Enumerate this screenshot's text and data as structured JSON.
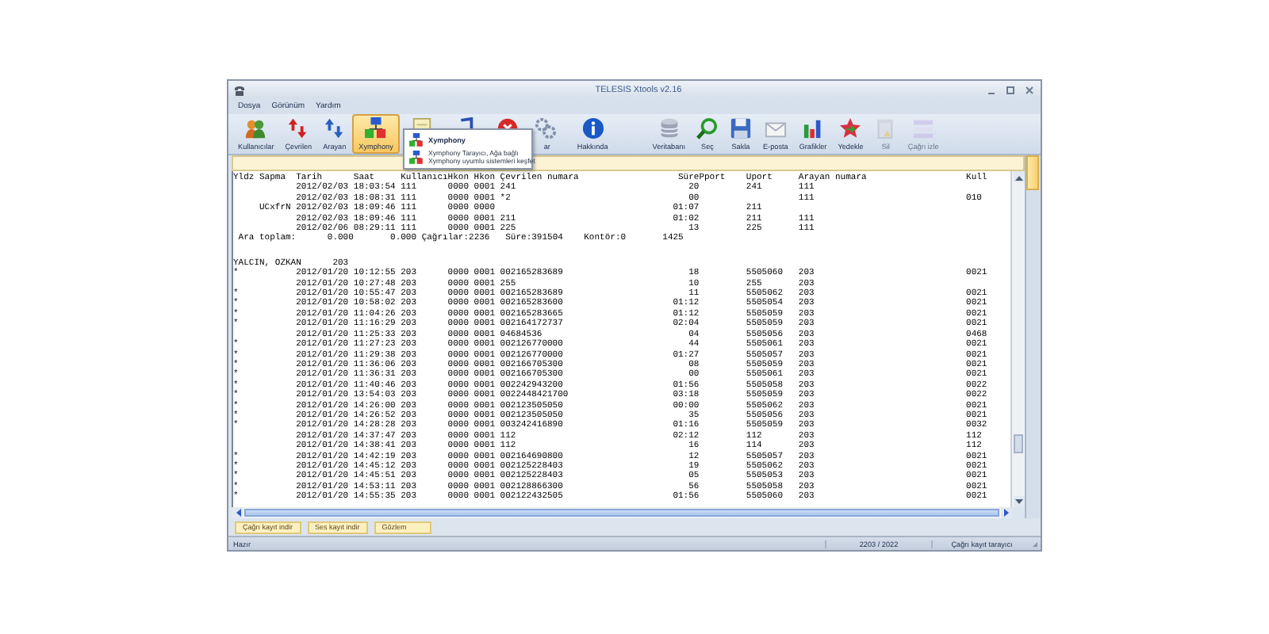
{
  "window": {
    "title": "TELESIS Xtools v2.16"
  },
  "menu": [
    "Dosya",
    "Görünüm",
    "Yardım"
  ],
  "toolbar": {
    "left": [
      {
        "kind": "users",
        "label": "Kullanıcılar",
        "highlighted": false,
        "disabled": false
      },
      {
        "kind": "dialed",
        "label": "Çevrilen",
        "highlighted": false,
        "disabled": false
      },
      {
        "kind": "caller",
        "label": "Arayan",
        "highlighted": false,
        "disabled": false
      },
      {
        "kind": "network",
        "label": "Xymphony",
        "highlighted": true,
        "disabled": false
      },
      {
        "kind": "notepad",
        "highlighted": false,
        "disabled": false
      },
      {
        "kind": "music",
        "highlighted": false,
        "disabled": false
      },
      {
        "kind": "stop",
        "highlighted": false,
        "disabled": false
      },
      {
        "kind": "gears",
        "label": "ar",
        "highlighted": false,
        "disabled": false
      },
      {
        "kind": "info",
        "label": "Hakkında",
        "highlighted": false,
        "disabled": false
      }
    ],
    "right": [
      {
        "kind": "database",
        "label": "Veritabanı",
        "highlighted": false,
        "disabled": false
      },
      {
        "kind": "search",
        "label": "Seç",
        "highlighted": false,
        "disabled": false
      },
      {
        "kind": "save",
        "label": "Sakla",
        "highlighted": false,
        "disabled": false
      },
      {
        "kind": "mail",
        "label": "E-posta",
        "highlighted": false,
        "disabled": false
      },
      {
        "kind": "chart",
        "label": "Grafikler",
        "highlighted": false,
        "disabled": false
      },
      {
        "kind": "star",
        "label": "Yedekle",
        "highlighted": false,
        "disabled": false
      },
      {
        "kind": "delete",
        "label": "Sil",
        "highlighted": false,
        "disabled": true
      },
      {
        "kind": "list",
        "label": "Çağrı izle",
        "highlighted": false,
        "disabled": true
      }
    ]
  },
  "tooltip": {
    "title": "Xymphony",
    "lines": [
      "Xymphony Tarayıcı, Ağa bağlı",
      "Xymphony uyumlu sistemleri keşfet"
    ]
  },
  "report": {
    "columns": [
      "Yldz",
      "Sapma",
      "Tarih",
      "Saat",
      "Kullanıcı",
      "Hkon",
      "Hkon",
      "Çevrilen numara",
      "Süre",
      "Pport",
      "Uport",
      "Arayan numara",
      "Kull"
    ],
    "lines": [
      {
        "kind": "call",
        "date": "2012/02/03",
        "time": "18:03:54",
        "user": "111",
        "hkon1": "0000",
        "hkon2": "0001",
        "dialed": "241",
        "duration": "20",
        "uport": "241",
        "caller": "111"
      },
      {
        "kind": "call",
        "date": "2012/02/03",
        "time": "18:08:31",
        "user": "111",
        "hkon1": "0000",
        "hkon2": "0001",
        "dialed": "*2",
        "duration": "00",
        "caller": "111",
        "kull": "010"
      },
      {
        "kind": "call",
        "sapma": "UCxfrN",
        "date": "2012/02/03",
        "time": "18:09:46",
        "user": "111",
        "hkon1": "0000",
        "hkon2": "0000",
        "duration": "01:07",
        "uport": "211"
      },
      {
        "kind": "call",
        "date": "2012/02/03",
        "time": "18:09:46",
        "user": "111",
        "hkon1": "0000",
        "hkon2": "0001",
        "dialed": "211",
        "duration": "01:02",
        "uport": "211",
        "caller": "111"
      },
      {
        "kind": "call",
        "date": "2012/02/06",
        "time": "08:29:11",
        "user": "111",
        "hkon1": "0000",
        "hkon2": "0001",
        "dialed": "225",
        "duration": "13",
        "uport": "225",
        "caller": "111"
      },
      {
        "kind": "subtotal",
        "text": " Ara toplam:      0.000       0.000 Çağrılar:2236   Süre:391504    Kontör:0       1425"
      },
      {
        "kind": "group",
        "text": "YALCIN, OZKAN      203"
      },
      {
        "kind": "call",
        "star": "*",
        "date": "2012/01/20",
        "time": "10:12:55",
        "user": "203",
        "hkon1": "0000",
        "hkon2": "0001",
        "dialed": "002165283689",
        "duration": "18",
        "uport": "5505060",
        "caller": "203",
        "kull": "0021"
      },
      {
        "kind": "call",
        "date": "2012/01/20",
        "time": "10:27:48",
        "user": "203",
        "hkon1": "0000",
        "hkon2": "0001",
        "dialed": "255",
        "duration": "10",
        "uport": "255",
        "caller": "203"
      },
      {
        "kind": "call",
        "star": "*",
        "date": "2012/01/20",
        "time": "10:55:47",
        "user": "203",
        "hkon1": "0000",
        "hkon2": "0001",
        "dialed": "002165283689",
        "duration": "11",
        "uport": "5505062",
        "caller": "203",
        "kull": "0021"
      },
      {
        "kind": "call",
        "star": "*",
        "date": "2012/01/20",
        "time": "10:58:02",
        "user": "203",
        "hkon1": "0000",
        "hkon2": "0001",
        "dialed": "002165283600",
        "duration": "01:12",
        "uport": "5505054",
        "caller": "203",
        "kull": "0021"
      },
      {
        "kind": "call",
        "star": "*",
        "date": "2012/01/20",
        "time": "11:04:26",
        "user": "203",
        "hkon1": "0000",
        "hkon2": "0001",
        "dialed": "002165283665",
        "duration": "01:12",
        "uport": "5505059",
        "caller": "203",
        "kull": "0021"
      },
      {
        "kind": "call",
        "star": "*",
        "date": "2012/01/20",
        "time": "11:16:29",
        "user": "203",
        "hkon1": "0000",
        "hkon2": "0001",
        "dialed": "002164172737",
        "duration": "02:04",
        "uport": "5505059",
        "caller": "203",
        "kull": "0021"
      },
      {
        "kind": "call",
        "date": "2012/01/20",
        "time": "11:25:33",
        "user": "203",
        "hkon1": "0000",
        "hkon2": "0001",
        "dialed": "04684536",
        "duration": "04",
        "uport": "5505056",
        "caller": "203",
        "kull": "0468"
      },
      {
        "kind": "call",
        "star": "*",
        "date": "2012/01/20",
        "time": "11:27:23",
        "user": "203",
        "hkon1": "0000",
        "hkon2": "0001",
        "dialed": "002126770000",
        "duration": "44",
        "uport": "5505061",
        "caller": "203",
        "kull": "0021"
      },
      {
        "kind": "call",
        "star": "*",
        "date": "2012/01/20",
        "time": "11:29:38",
        "user": "203",
        "hkon1": "0000",
        "hkon2": "0001",
        "dialed": "002126770000",
        "duration": "01:27",
        "uport": "5505057",
        "caller": "203",
        "kull": "0021"
      },
      {
        "kind": "call",
        "star": "*",
        "date": "2012/01/20",
        "time": "11:36:06",
        "user": "203",
        "hkon1": "0000",
        "hkon2": "0001",
        "dialed": "002166705300",
        "duration": "08",
        "uport": "5505059",
        "caller": "203",
        "kull": "0021"
      },
      {
        "kind": "call",
        "star": "*",
        "date": "2012/01/20",
        "time": "11:36:31",
        "user": "203",
        "hkon1": "0000",
        "hkon2": "0001",
        "dialed": "002166705300",
        "duration": "00",
        "uport": "5505061",
        "caller": "203",
        "kull": "0021"
      },
      {
        "kind": "call",
        "star": "*",
        "date": "2012/01/20",
        "time": "11:40:46",
        "user": "203",
        "hkon1": "0000",
        "hkon2": "0001",
        "dialed": "002242943200",
        "duration": "01:56",
        "uport": "5505058",
        "caller": "203",
        "kull": "0022"
      },
      {
        "kind": "call",
        "star": "*",
        "date": "2012/01/20",
        "time": "13:54:03",
        "user": "203",
        "hkon1": "0000",
        "hkon2": "0001",
        "dialed": "0022448421700",
        "duration": "03:18",
        "uport": "5505059",
        "caller": "203",
        "kull": "0022"
      },
      {
        "kind": "call",
        "star": "*",
        "date": "2012/01/20",
        "time": "14:26:00",
        "user": "203",
        "hkon1": "0000",
        "hkon2": "0001",
        "dialed": "002123505050",
        "duration": "00:00",
        "uport": "5505062",
        "caller": "203",
        "kull": "0021"
      },
      {
        "kind": "call",
        "star": "*",
        "date": "2012/01/20",
        "time": "14:26:52",
        "user": "203",
        "hkon1": "0000",
        "hkon2": "0001",
        "dialed": "002123505050",
        "duration": "35",
        "uport": "5505056",
        "caller": "203",
        "kull": "0021"
      },
      {
        "kind": "call",
        "star": "*",
        "date": "2012/01/20",
        "time": "14:28:28",
        "user": "203",
        "hkon1": "0000",
        "hkon2": "0001",
        "dialed": "003242416890",
        "duration": "01:16",
        "uport": "5505059",
        "caller": "203",
        "kull": "0032"
      },
      {
        "kind": "call",
        "date": "2012/01/20",
        "time": "14:37:47",
        "user": "203",
        "hkon1": "0000",
        "hkon2": "0001",
        "dialed": "112",
        "duration": "02:12",
        "uport": "112",
        "caller": "203",
        "kull": "112"
      },
      {
        "kind": "call",
        "date": "2012/01/20",
        "time": "14:38:41",
        "user": "203",
        "hkon1": "0000",
        "hkon2": "0001",
        "dialed": "112",
        "duration": "16",
        "uport": "114",
        "caller": "203",
        "kull": "112"
      },
      {
        "kind": "call",
        "star": "*",
        "date": "2012/01/20",
        "time": "14:42:19",
        "user": "203",
        "hkon1": "0000",
        "hkon2": "0001",
        "dialed": "002164690800",
        "duration": "12",
        "uport": "5505057",
        "caller": "203",
        "kull": "0021"
      },
      {
        "kind": "call",
        "star": "*",
        "date": "2012/01/20",
        "time": "14:45:12",
        "user": "203",
        "hkon1": "0000",
        "hkon2": "0001",
        "dialed": "002125228403",
        "duration": "19",
        "uport": "5505062",
        "caller": "203",
        "kull": "0021"
      },
      {
        "kind": "call",
        "star": "*",
        "date": "2012/01/20",
        "time": "14:45:51",
        "user": "203",
        "hkon1": "0000",
        "hkon2": "0001",
        "dialed": "002125228403",
        "duration": "05",
        "uport": "5505053",
        "caller": "203",
        "kull": "0021"
      },
      {
        "kind": "call",
        "star": "*",
        "date": "2012/01/20",
        "time": "14:53:11",
        "user": "203",
        "hkon1": "0000",
        "hkon2": "0001",
        "dialed": "002128866300",
        "duration": "56",
        "uport": "5505058",
        "caller": "203",
        "kull": "0021"
      },
      {
        "kind": "call",
        "star": "*",
        "date": "2012/01/20",
        "time": "14:55:35",
        "user": "203",
        "hkon1": "0000",
        "hkon2": "0001",
        "dialed": "002122432505",
        "duration": "01:56",
        "uport": "5505060",
        "caller": "203",
        "kull": "0021"
      }
    ]
  },
  "bottom_tabs": [
    "Çağrı kayıt indir",
    "Ses kayıt indir",
    "Gözlem"
  ],
  "status_bar": {
    "state": "Hazır",
    "count": "2203 / 2022",
    "mode": "Çağrı kayıt tarayıcı"
  }
}
